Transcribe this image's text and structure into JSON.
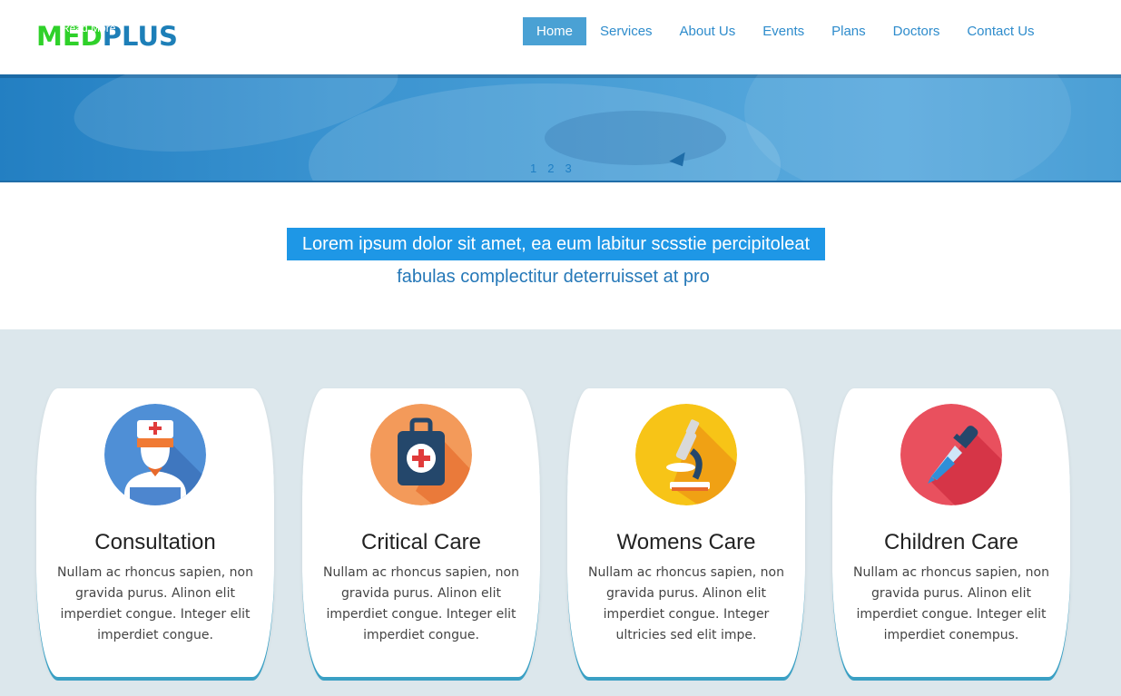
{
  "header": {
    "logo_part1": "MED",
    "logo_part2": "PLUS",
    "logo_overlay": "Read More",
    "nav": [
      {
        "label": "Home",
        "active": true
      },
      {
        "label": "Services"
      },
      {
        "label": "About Us"
      },
      {
        "label": "Events"
      },
      {
        "label": "Plans"
      },
      {
        "label": "Doctors"
      },
      {
        "label": "Contact Us"
      }
    ]
  },
  "hero": {
    "slides": [
      "1",
      "2",
      "3"
    ]
  },
  "intro": {
    "line1": "Lorem ipsum dolor sit amet, ea eum labitur scsstie percipitoleat",
    "line2": "fabulas complectitur deterruisset at pro"
  },
  "services": [
    {
      "title": "Consultation",
      "icon": "doctor-icon",
      "color": "#4f8fd6",
      "desc": "Nullam ac rhoncus sapien, non gravida purus. Alinon elit imperdiet congue. Integer elit imperdiet congue."
    },
    {
      "title": "Critical Care",
      "icon": "first-aid-kit-icon",
      "color": "#f39a5a",
      "desc": "Nullam ac rhoncus sapien, non gravida purus. Alinon elit imperdiet congue. Integer elit imperdiet congue."
    },
    {
      "title": "Womens Care",
      "icon": "microscope-icon",
      "color": "#f7c417",
      "desc": "Nullam ac rhoncus sapien, non gravida purus. Alinon elit imperdiet congue. Integer ultricies sed elit impe."
    },
    {
      "title": "Children Care",
      "icon": "dropper-icon",
      "color": "#e9505e",
      "desc": "Nullam ac rhoncus sapien, non gravida purus. Alinon elit imperdiet congue. Integer elit imperdiet conempus."
    }
  ]
}
